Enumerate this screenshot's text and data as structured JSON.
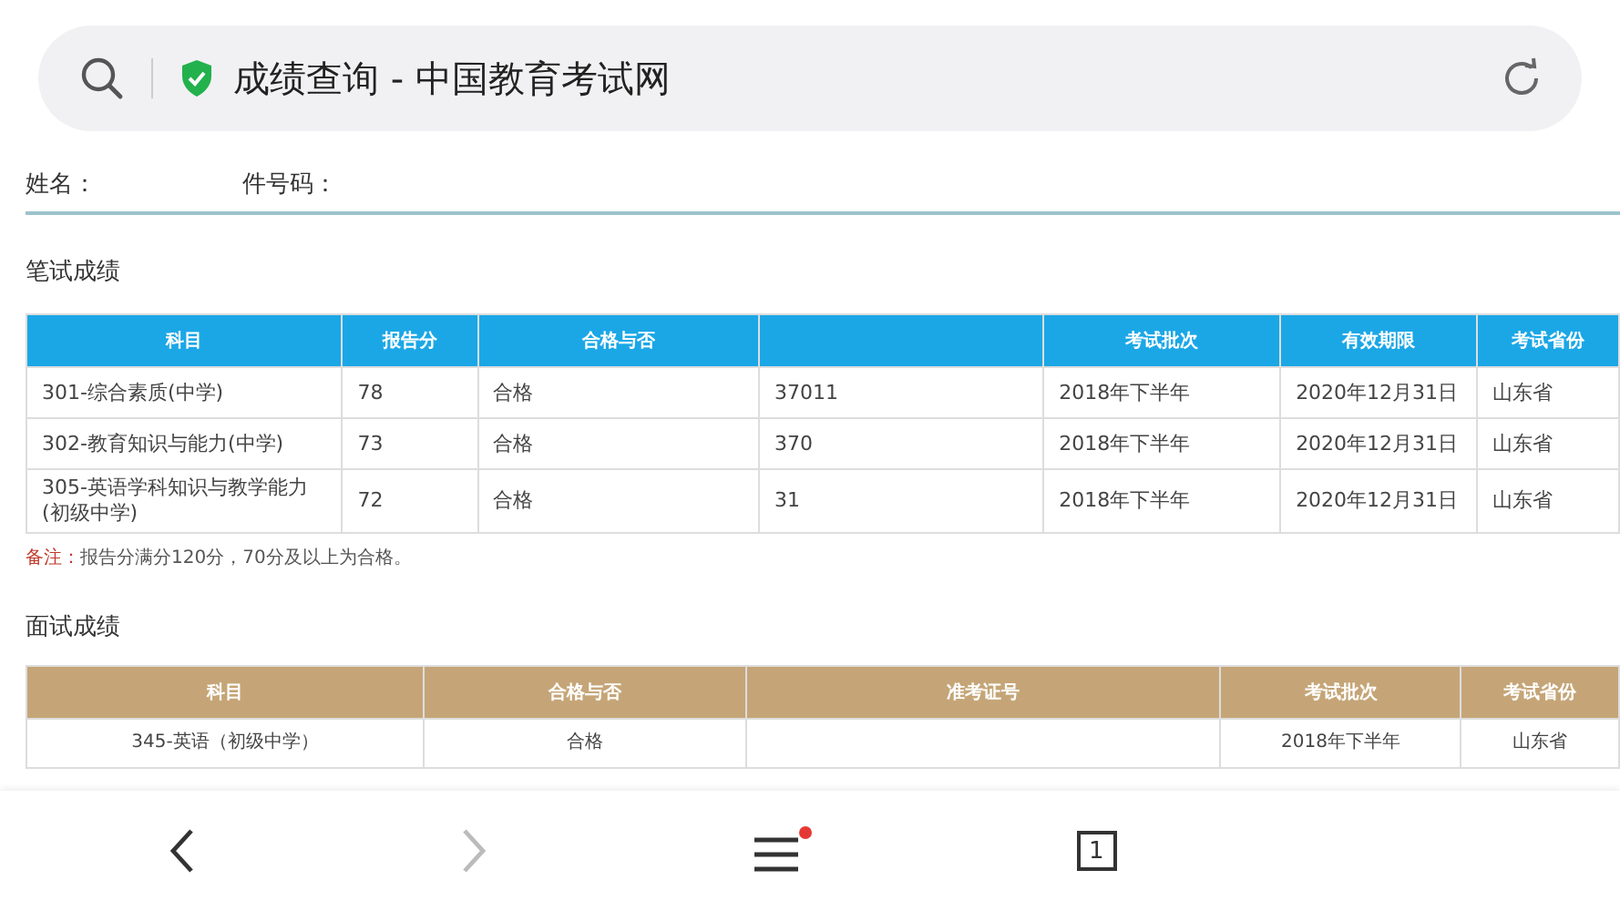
{
  "address_bar": {
    "title": "成绩查询 - 中国教育考试网",
    "secure": true
  },
  "identity": {
    "name_label": "姓名：",
    "id_label": "件号码："
  },
  "written": {
    "title": "笔试成绩",
    "columns": [
      "科目",
      "报告分",
      "合格与否",
      "",
      "考试批次",
      "有效期限",
      "考试省份"
    ],
    "rows": [
      [
        "301-综合素质(中学)",
        "78",
        "合格",
        "37011",
        "2018年下半年",
        "2020年12月31日",
        "山东省"
      ],
      [
        "302-教育知识与能力(中学)",
        "73",
        "合格",
        "370",
        "2018年下半年",
        "2020年12月31日",
        "山东省"
      ],
      [
        "305-英语学科知识与教学能力(初级中学)",
        "72",
        "合格",
        "31",
        "2018年下半年",
        "2020年12月31日",
        "山东省"
      ]
    ],
    "note_label": "备注：",
    "note": "报告分满分120分，70分及以上为合格。"
  },
  "interview": {
    "title": "面试成绩",
    "columns": [
      "科目",
      "合格与否",
      "准考证号",
      "考试批次",
      "考试省份"
    ],
    "rows": [
      [
        "345-英语（初级中学）",
        "合格",
        "",
        "2018年下半年",
        "山东省"
      ]
    ]
  },
  "bottom_bar": {
    "back_disabled": false,
    "forward_disabled": true,
    "menu_badge": true,
    "tab_count": "1"
  }
}
